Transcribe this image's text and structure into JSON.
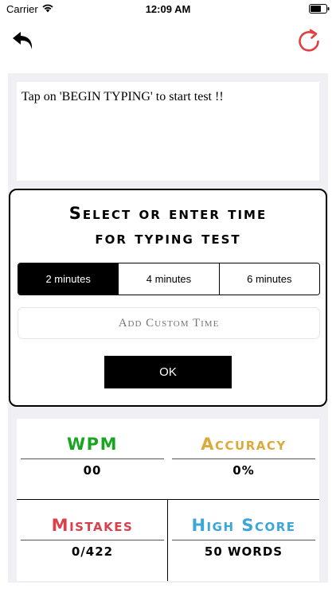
{
  "status_bar": {
    "carrier": "Carrier",
    "time": "12:09 AM"
  },
  "nav": {
    "back_icon": "undo-arrow-icon",
    "refresh_icon": "refresh-icon",
    "refresh_color": "#e0403f"
  },
  "prompt_text": "Tap on 'BEGIN TYPING' to start test !!",
  "dialog": {
    "title_line1": "Select or enter time",
    "title_line2": "for typing test",
    "segments": [
      "2 minutes",
      "4 minutes",
      "6 minutes"
    ],
    "selected_segment": "2 minutes",
    "custom_time_placeholder": "Add Custom Time",
    "ok_label": "OK"
  },
  "stats": {
    "wpm": {
      "label": "WPM",
      "value": "00",
      "color": "#1aa521"
    },
    "accuracy": {
      "label": "Accuracy",
      "value": "0%",
      "color": "#dcaa3c"
    },
    "mistakes": {
      "label": "Mistakes",
      "value": "0/422",
      "color": "#d9404c"
    },
    "high_score": {
      "label": "High Score",
      "value": "50 WORDS",
      "color": "#3aa6d9"
    }
  }
}
